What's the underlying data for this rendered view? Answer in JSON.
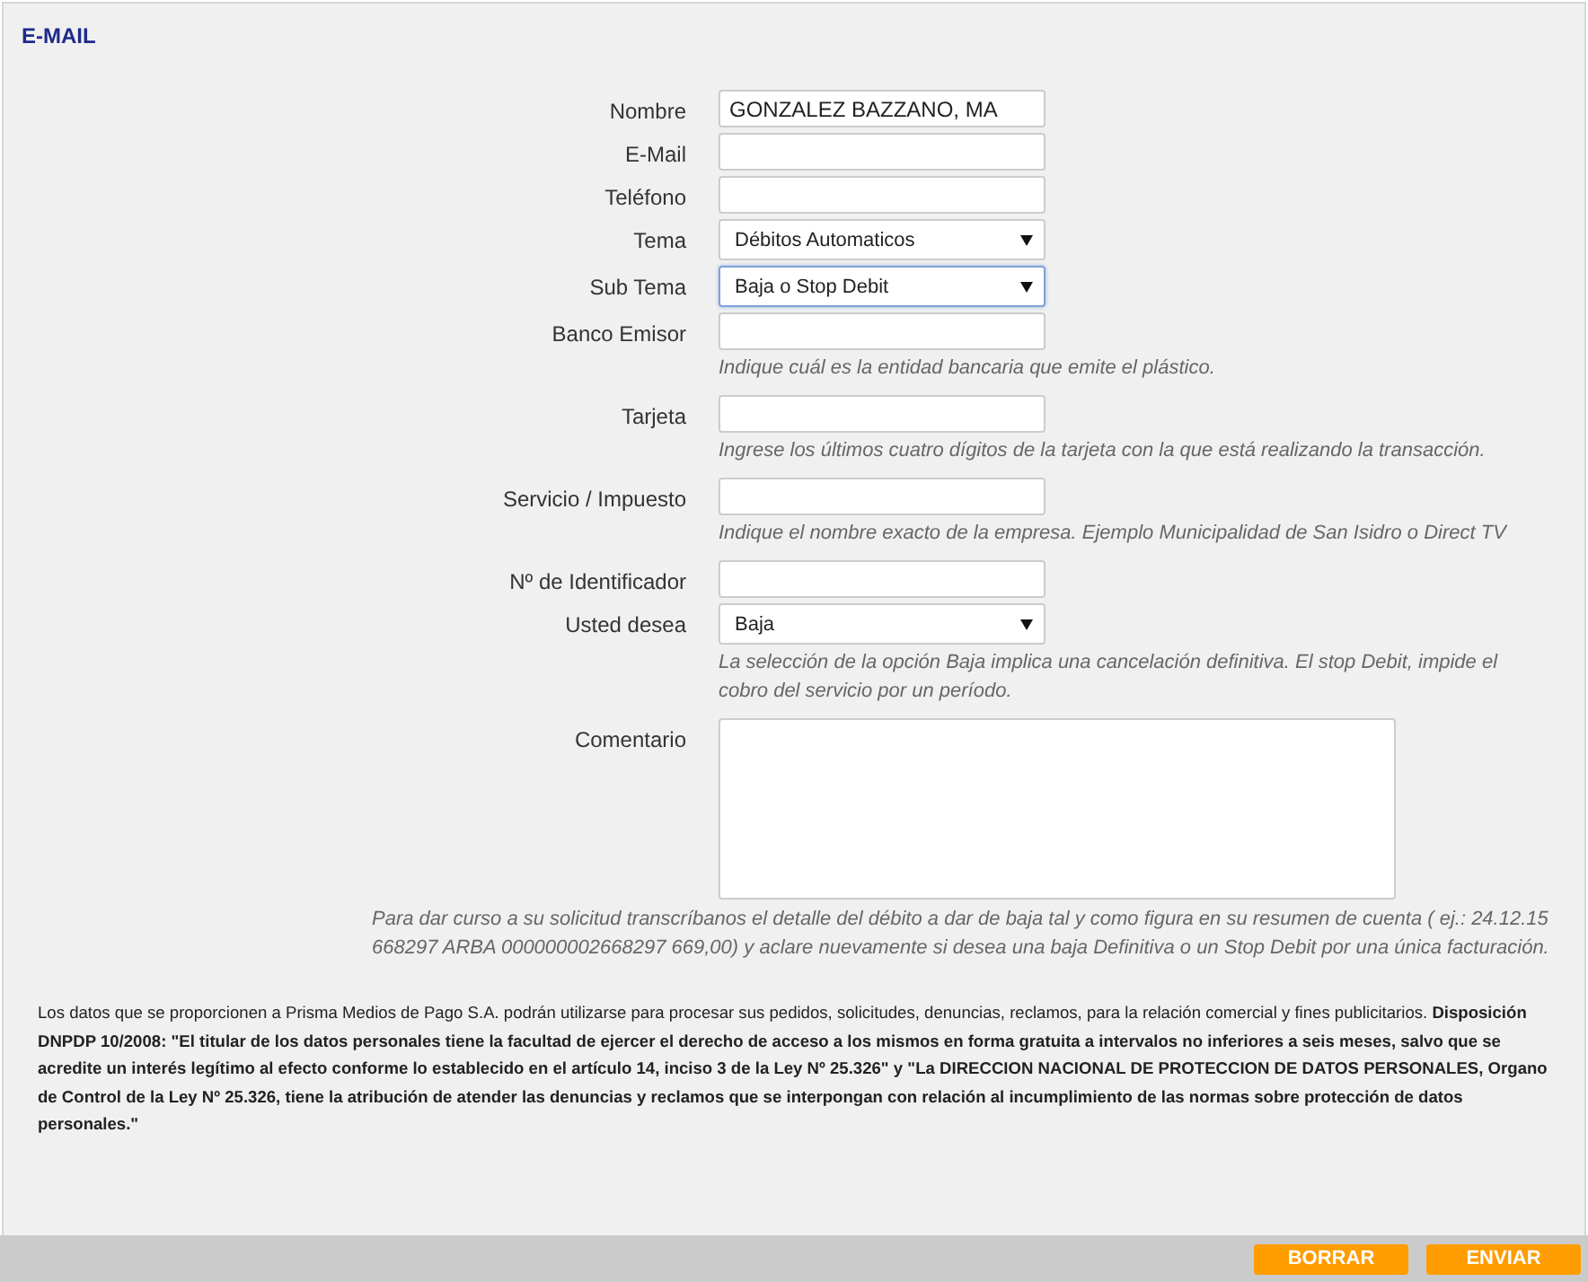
{
  "header": {
    "title": "E-MAIL"
  },
  "fields": [
    {
      "label": "Nombre",
      "kind": "text",
      "value": "GONZALEZ BAZZANO, MA"
    },
    {
      "label": "E-Mail",
      "kind": "text"
    },
    {
      "label": "Teléfono",
      "kind": "text"
    },
    {
      "label": "Tema",
      "kind": "select",
      "value": "Débitos Automaticos",
      "focused": false
    },
    {
      "label": "Sub Tema",
      "kind": "select",
      "value": "Baja o Stop Debit",
      "focused": true
    },
    {
      "label": "Banco Emisor",
      "kind": "text",
      "hint": "Indique cuál es la entidad bancaria que emite el plástico."
    },
    {
      "label": "Tarjeta",
      "kind": "text",
      "hint": "Ingrese los últimos cuatro dígitos de la tarjeta con la que está realizando la transacción."
    },
    {
      "label": "Servicio / Impuesto",
      "kind": "text",
      "hint": "Indique el nombre exacto de la empresa. Ejemplo Municipalidad de San Isidro o Direct TV"
    },
    {
      "label": "Nº de Identificador",
      "kind": "text"
    },
    {
      "label": "Usted desea",
      "kind": "select",
      "value": "Baja",
      "focused": false,
      "hint": "La selección de la opción Baja implica una cancelación definitiva. El stop Debit, impide el cobro del servicio por un período."
    },
    {
      "label": "Comentario",
      "kind": "textarea"
    }
  ],
  "note": "Para dar curso a su solicitud transcríbanos el detalle del débito a dar de baja tal y como figura en su resumen de cuenta ( ej.: 24.12.15 668297 ARBA 000000002668297 669,00) y aclare nuevamente si desea una baja Definitiva o un Stop Debit por una única facturación.",
  "legal": "Los datos que se proporcionen a Prisma Medios de Pago S.A. podrán utilizarse para procesar sus pedidos, solicitudes, denuncias, reclamos, para la relación comercial y fines publicitarios. **Disposición DNPDP 10/2008: \"El titular de los datos personales tiene la facultad de ejercer el derecho de acceso a los mismos en forma gratuita a intervalos no inferiores a seis meses, salvo que se acredite un interés legítimo al efecto conforme lo establecido en el artículo 14, inciso 3 de la Ley Nº 25.326\" y \"La DIRECCION NACIONAL DE PROTECCION DE DATOS PERSONALES, Organo de Control de la Ley Nº 25.326, tiene la atribución de atender las denuncias y reclamos que se interpongan con relación al incumplimiento de las normas sobre protección de datos personales.\"**",
  "buttons": [
    "BORRAR",
    "ENVIAR"
  ]
}
